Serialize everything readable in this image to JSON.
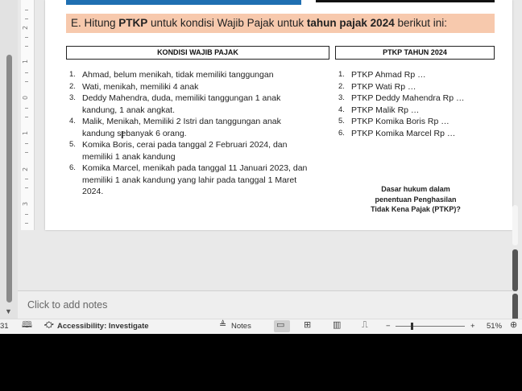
{
  "ruler": {
    "numbers": [
      "2",
      "1",
      "0",
      "1",
      "2",
      "3"
    ]
  },
  "slide": {
    "question": {
      "prefix": "E. Hitung ",
      "bold1": "PTKP",
      "middle": " untuk kondisi Wajib Pajak untuk ",
      "bold2": "tahun pajak 2024",
      "suffix": " berikut ini:"
    },
    "left_header": "KONDISI WAJIB PAJAK",
    "right_header": "PTKP TAHUN 2024",
    "conditions": [
      {
        "n": "1.",
        "lines": [
          "Ahmad, belum menikah, tidak memiliki tanggungan"
        ]
      },
      {
        "n": "2.",
        "lines": [
          "Wati, menikah, memiliki 4 anak"
        ]
      },
      {
        "n": "3.",
        "lines": [
          "Deddy Mahendra, duda, memiliki tanggungan 1 anak",
          "kandung, 1 anak angkat."
        ]
      },
      {
        "n": "4.",
        "lines": [
          "Malik, Menikah, Memiliki 2 Istri dan tanggungan anak",
          "kandung sebanyak 6 orang."
        ]
      },
      {
        "n": "5.",
        "lines": [
          "Komika Boris, cerai pada tanggal 2 Februari 2024, dan",
          "memiliki 1 anak kandung"
        ]
      },
      {
        "n": "6.",
        "lines": [
          "Komika Marcel, menikah pada tanggal 11 Januari 2023, dan",
          "memiliki 1 anak kandung yang lahir pada tanggal 1 Maret",
          "2024."
        ]
      }
    ],
    "ptkp": [
      {
        "n": "1.",
        "text": "PTKP Ahmad  Rp …"
      },
      {
        "n": "2.",
        "text": "PTKP Wati  Rp …"
      },
      {
        "n": "3.",
        "text": "PTKP Deddy Mahendra  Rp …"
      },
      {
        "n": "4.",
        "text": "PTKP Malik  Rp …"
      },
      {
        "n": "5.",
        "text": "PTKP Komika Boris  Rp …"
      },
      {
        "n": "6.",
        "text": "PTKP Komika Marcel  Rp …"
      }
    ],
    "dasar_lines": [
      "Dasar hukum dalam",
      "penentuan Penghasilan",
      "Tidak Kena Pajak (PTKP)?"
    ]
  },
  "notes_placeholder": "Click to add notes",
  "status": {
    "slide_num": "31",
    "accessibility": "Accessibility: Investigate",
    "notes_label": "Notes",
    "zoom_minus": "−",
    "zoom_plus": "+",
    "zoom_level": "51%"
  },
  "icons": {
    "book": "book-icon",
    "accessibility": "accessibility-icon",
    "notes": "notes-icon",
    "normal_view": "normal-view-icon",
    "sorter": "slide-sorter-icon",
    "reading": "reading-view-icon",
    "presenter": "slideshow-icon"
  }
}
